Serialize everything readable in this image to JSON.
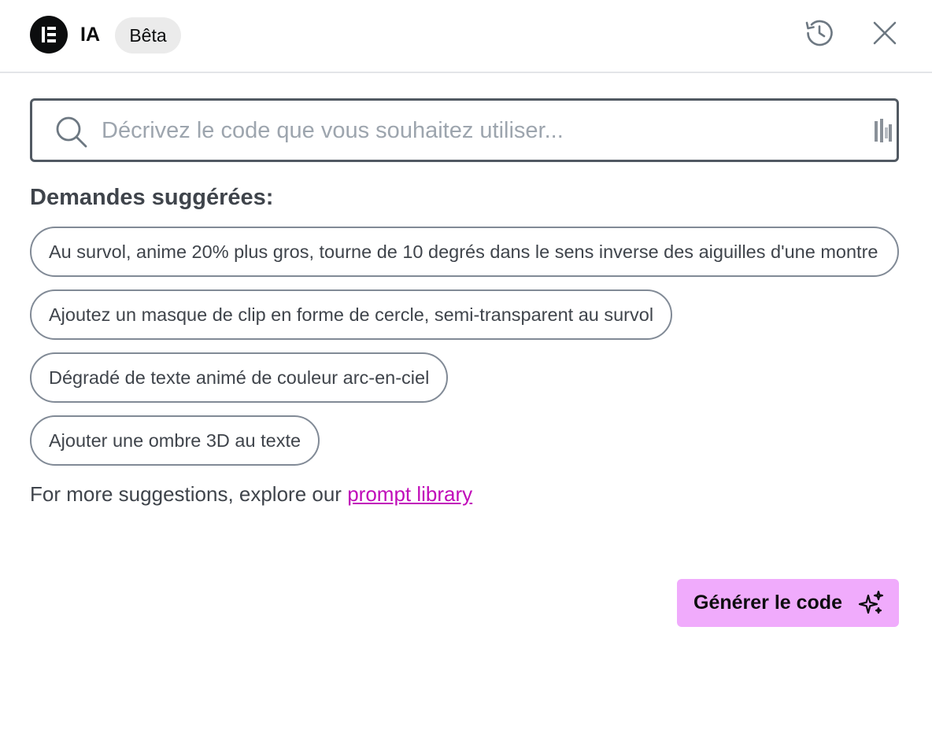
{
  "header": {
    "title": "IA",
    "badge": "Bêta",
    "logo_icon": "elementor-logo-icon",
    "history_icon": "history-icon",
    "close_icon": "close-icon"
  },
  "search": {
    "placeholder": "Décrivez le code que vous souhaitez utiliser...",
    "value": "",
    "icon": "search-icon"
  },
  "suggestions": {
    "title": "Demandes suggérées:",
    "items": [
      {
        "label": "Au survol, anime 20% plus gros, tourne de 10 degrés dans le sens inverse des aiguilles d'une montre"
      },
      {
        "label": "Ajoutez un masque de clip en forme de cercle, semi-transparent au survol"
      },
      {
        "label": "Dégradé de texte animé de couleur arc-en-ciel"
      },
      {
        "label": "Ajouter une ombre 3D au texte"
      }
    ]
  },
  "more": {
    "prefix": "For more suggestions, explore our ",
    "link": "prompt library"
  },
  "generate": {
    "label": "Générer le code",
    "icon": "sparkle-icon"
  },
  "colors": {
    "accent": "#f0abfc",
    "link": "#c00bb9",
    "text": "#3f444b"
  }
}
